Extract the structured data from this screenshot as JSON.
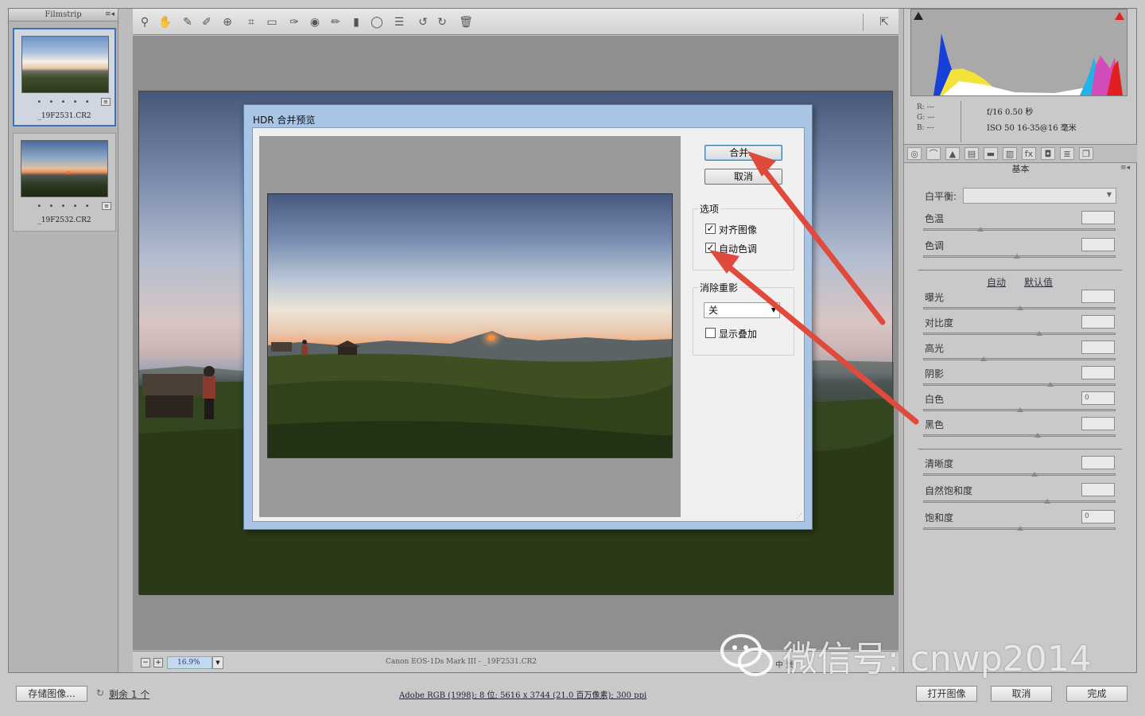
{
  "filmstrip": {
    "title": "Filmstrip",
    "items": [
      {
        "name": "_19F2531.CR2",
        "rating": "• • • • •",
        "selected": true
      },
      {
        "name": "_19F2532.CR2",
        "rating": "• • • • •",
        "selected": false
      }
    ]
  },
  "toolbar": {
    "tools": [
      "zoom-icon",
      "hand-icon",
      "white-balance-icon",
      "color-sampler-icon",
      "target-adjust-icon",
      "crop-icon",
      "straighten-icon",
      "spot-removal-icon",
      "red-eye-icon",
      "adjustment-brush-icon",
      "graduated-filter-icon",
      "radial-filter-icon",
      "presets-icon",
      "rotate-left-icon",
      "rotate-right-icon",
      "trash-icon"
    ],
    "fullscreen": "fullscreen-icon"
  },
  "status": {
    "zoom": "16.9%",
    "camera": "Canon EOS-1Ds Mark III  -  _19F2531.CR2",
    "workflow": "中 景"
  },
  "histogram": {
    "rgb": {
      "r": "R:  ---",
      "g": "G:  ---",
      "b": "B:  ---"
    },
    "aperture_shutter": "f/16   0.50 秒",
    "iso_lens": "ISO 50   16-35@16 毫米"
  },
  "panel": {
    "title": "基本",
    "wb_label": "白平衡:",
    "wb_value": "",
    "temp": {
      "label": "色温",
      "value": ""
    },
    "tint": {
      "label": "色调",
      "value": ""
    },
    "auto": "自动",
    "default": "默认值",
    "exposure": {
      "label": "曝光",
      "value": ""
    },
    "contrast": {
      "label": "对比度",
      "value": ""
    },
    "highlights": {
      "label": "高光",
      "value": ""
    },
    "shadows": {
      "label": "阴影",
      "value": ""
    },
    "whites": {
      "label": "白色",
      "value": "0"
    },
    "blacks": {
      "label": "黑色",
      "value": ""
    },
    "clarity": {
      "label": "清晰度",
      "value": ""
    },
    "vibrance": {
      "label": "自然饱和度",
      "value": ""
    },
    "saturation": {
      "label": "饱和度",
      "value": "0"
    }
  },
  "dialog": {
    "title": "HDR 合并预览",
    "merge": "合并...",
    "cancel": "取消",
    "options_label": "选项",
    "align_images": "对齐图像",
    "auto_tone": "自动色调",
    "deghost_label": "消除重影",
    "deghost_value": "关",
    "show_overlay": "显示叠加"
  },
  "bottom": {
    "save": "存储图像...",
    "remaining": "剩余 1 个",
    "info": "Adobe RGB (1998); 8 位; 5616 x 3744 (21.0 百万像素); 300 ppi",
    "open": "打开图像",
    "cancel": "取消",
    "done": "完成"
  },
  "watermark": "微信号: cnwp2014",
  "colors": {
    "accent": "#3f6fb5",
    "arrow": "#e04a3c",
    "dialog_frame": "#a9c5e6"
  }
}
